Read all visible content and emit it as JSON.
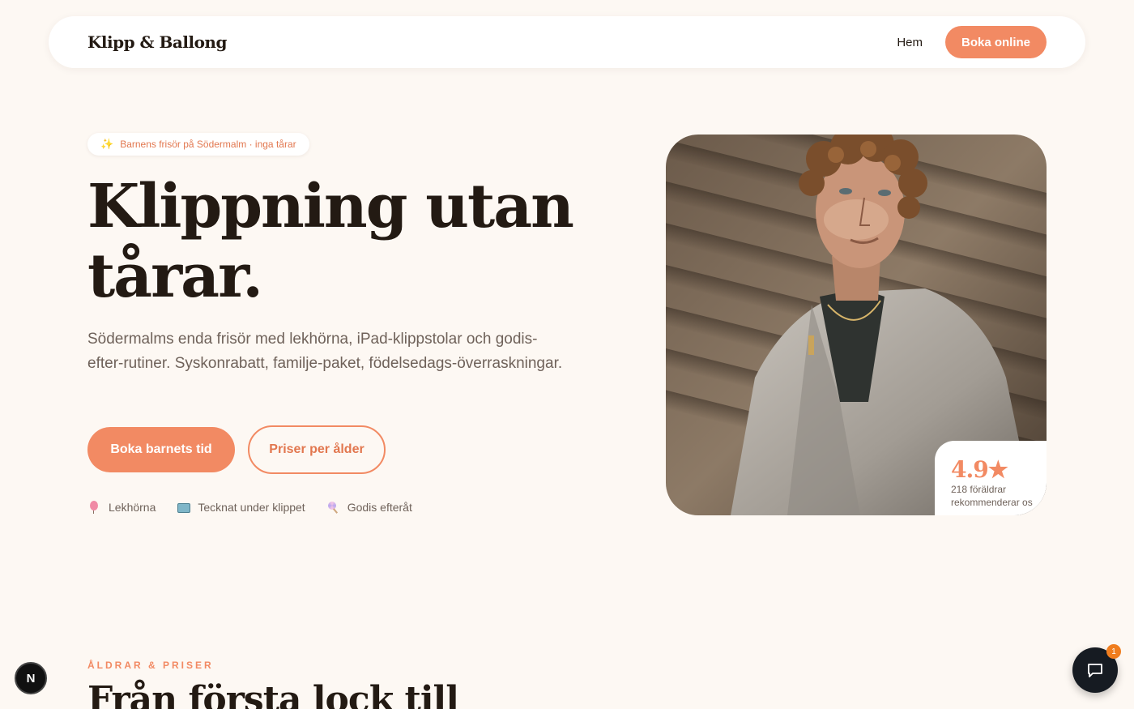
{
  "nav": {
    "brand": "Klipp & Ballong",
    "link_home": "Hem",
    "cta": "Boka online"
  },
  "hero": {
    "badge": "Barnens frisör på Södermalm · inga tårar",
    "badge_icon": "sparkle-icon",
    "title_line1": "Klippning utan",
    "title_line2": "tårar.",
    "lead": "Södermalms enda frisör med lekhörna, iPad-klippstolar och godis-efter-rutiner. Syskonrabatt, familje-paket, födelsedags-överraskningar.",
    "primary_button": "Boka barnets tid",
    "secondary_button": "Priser per ålder",
    "features": [
      {
        "icon": "balloon-icon",
        "label": "Lekhörna"
      },
      {
        "icon": "tv-icon",
        "label": "Tecknat under klippet"
      },
      {
        "icon": "lollipop-icon",
        "label": "Godis efteråt"
      }
    ]
  },
  "rating": {
    "score": "4.9★",
    "text": "218 föräldrar rekommenderar os"
  },
  "section": {
    "eyebrow": "ÅLDRAR & PRISER",
    "title": "Från första lock till"
  },
  "floating": {
    "dev_badge": "N",
    "chat_count": "1"
  },
  "colors": {
    "accent": "#f28a63",
    "background": "#fdf8f3",
    "text": "#231a13",
    "muted": "#6f625a"
  }
}
